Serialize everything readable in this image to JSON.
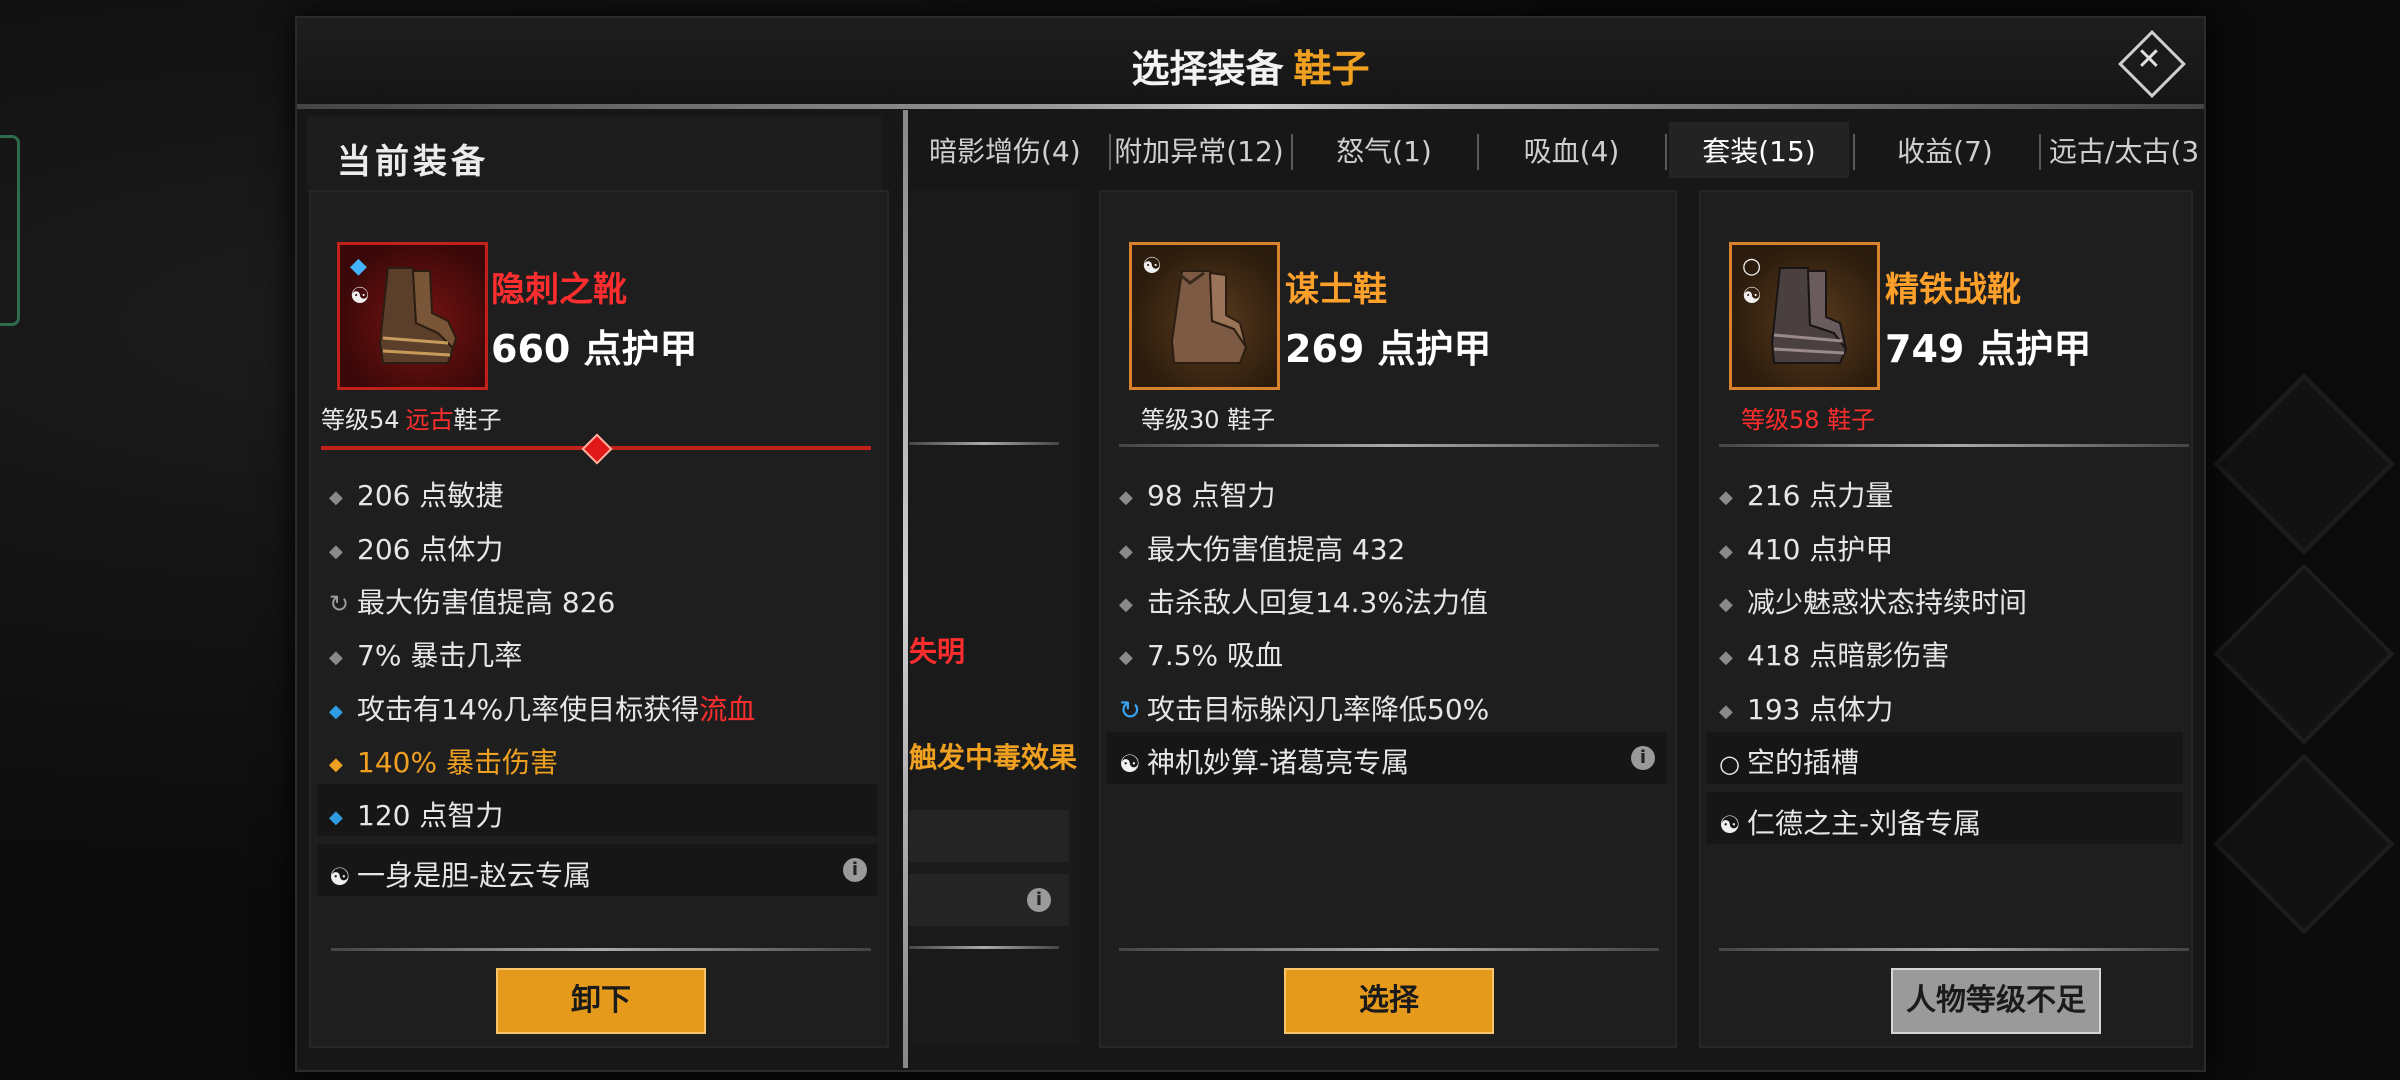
{
  "modal": {
    "title": "选择装备",
    "title_slot": "鞋子",
    "close_glyph": "✕"
  },
  "current": {
    "header": "当前装备",
    "item": {
      "name": "隐刺之靴",
      "armor": "660 点护甲",
      "level_prefix": "等级54",
      "level_rarity": "远古",
      "level_slot": "鞋子",
      "stats": [
        {
          "text": "206 点敏捷"
        },
        {
          "text": "206 点体力"
        },
        {
          "text": "最大伤害值提高 826"
        },
        {
          "text": "7% 暴击几率"
        },
        {
          "text": "攻击有14%几率使目标获得",
          "highlight": "流血"
        },
        {
          "text": "140% 暴击伤害"
        },
        {
          "text": "120 点智力"
        },
        {
          "text": "一身是胆-赵云专属"
        }
      ],
      "info_glyph": "i",
      "button": "卸下"
    }
  },
  "tabs": [
    {
      "label": "暗影增伤(4)"
    },
    {
      "label": "附加异常(12)"
    },
    {
      "label": "怒气(1)"
    },
    {
      "label": "吸血(4)"
    },
    {
      "label": "套装(15)",
      "active": true
    },
    {
      "label": "收益(7)"
    },
    {
      "label": "远古/太古(3"
    }
  ],
  "partial_card": {
    "text1": "失明",
    "text2": "触发中毒效果"
  },
  "items": [
    {
      "name": "谋士鞋",
      "armor": "269 点护甲",
      "level": "等级30 鞋子",
      "stats": [
        {
          "text": "98 点智力"
        },
        {
          "text": "最大伤害值提高 432"
        },
        {
          "text": "击杀敌人回复14.3%法力值"
        },
        {
          "text": "7.5% 吸血"
        },
        {
          "text": "攻击目标躲闪几率降低50%"
        },
        {
          "text": "神机妙算-诸葛亮专属"
        }
      ],
      "button": "选择"
    },
    {
      "name": "精铁战靴",
      "armor": "749 点护甲",
      "level": "等级58 鞋子",
      "stats": [
        {
          "text": "216 点力量"
        },
        {
          "text": "410 点护甲"
        },
        {
          "text": "减少魅惑状态持续时间"
        },
        {
          "text": "418 点暗影伤害"
        },
        {
          "text": "193 点体力"
        },
        {
          "text": "空的插槽"
        },
        {
          "text": "仁德之主-刘备专属"
        }
      ],
      "button": "人物等级不足"
    }
  ],
  "colors": {
    "accent": "#f0a020",
    "legendary_red": "#ff2d2d",
    "button": "#e59a1c"
  }
}
